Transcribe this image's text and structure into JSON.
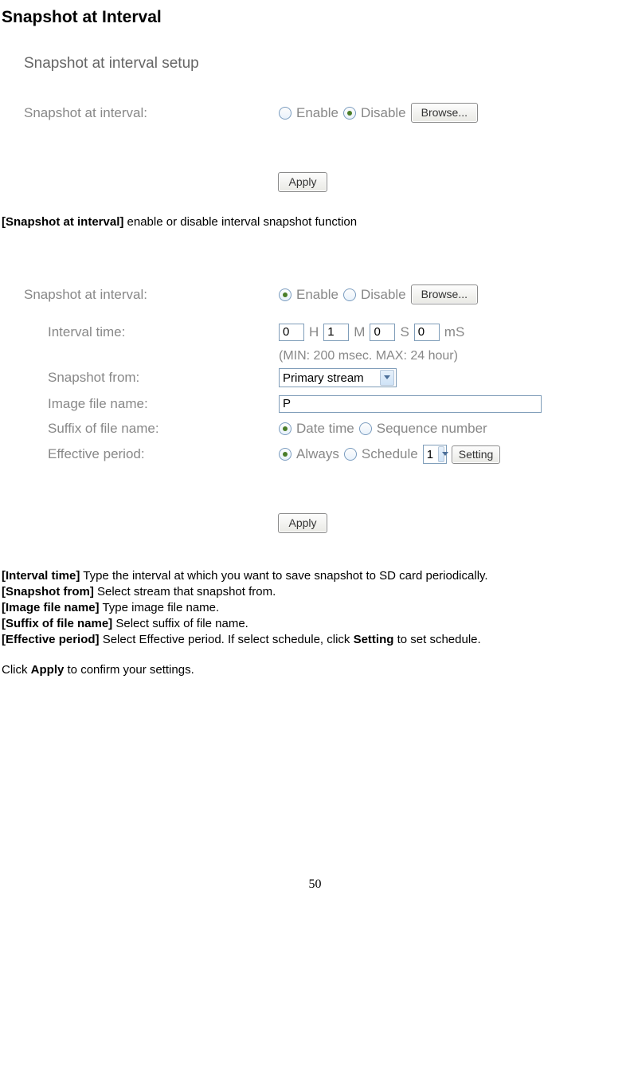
{
  "title": "Snapshot at Interval",
  "panel1": {
    "setup_title": "Snapshot at interval setup",
    "label": "Snapshot at interval:",
    "enable": "Enable",
    "disable": "Disable",
    "browse": "Browse...",
    "apply": "Apply"
  },
  "desc1_bold": "[Snapshot at interval]",
  "desc1_rest": " enable or disable interval snapshot function",
  "panel2": {
    "label_main": "Snapshot at interval:",
    "enable": "Enable",
    "disable": "Disable",
    "browse": "Browse...",
    "interval_label": "Interval time:",
    "h_val": "0",
    "h_unit": "H",
    "m_val": "1",
    "m_unit": "M",
    "s_val": "0",
    "s_unit": "S",
    "ms_val": "0",
    "ms_unit": "mS",
    "hint": "(MIN: 200 msec. MAX: 24 hour)",
    "from_label": "Snapshot from:",
    "from_value": "Primary stream",
    "filename_label": "Image file name:",
    "filename_value": "P",
    "suffix_label": "Suffix of file name:",
    "suffix_datetime": "Date time",
    "suffix_sequence": "Sequence number",
    "period_label": "Effective period:",
    "period_always": "Always",
    "period_schedule": "Schedule",
    "schedule_num": "1",
    "setting_btn": "Setting",
    "apply": "Apply"
  },
  "desc2": [
    {
      "b": "[Interval time]",
      "t": " Type the interval at which you want to save snapshot to SD card periodically."
    },
    {
      "b": "[Snapshot from]",
      "t": " Select stream that snapshot from."
    },
    {
      "b": "[Image file name]",
      "t": " Type image file name."
    },
    {
      "b": "[Suffix of file name]",
      "t": " Select suffix of file name."
    }
  ],
  "desc2_eff_b": "[Effective period]",
  "desc2_eff_1": " Select Effective period. If select schedule, click ",
  "desc2_eff_setting": "Setting",
  "desc2_eff_2": " to set schedule.",
  "confirm_1": "Click ",
  "confirm_apply": "Apply",
  "confirm_2": " to confirm your settings.",
  "page_number": "50"
}
